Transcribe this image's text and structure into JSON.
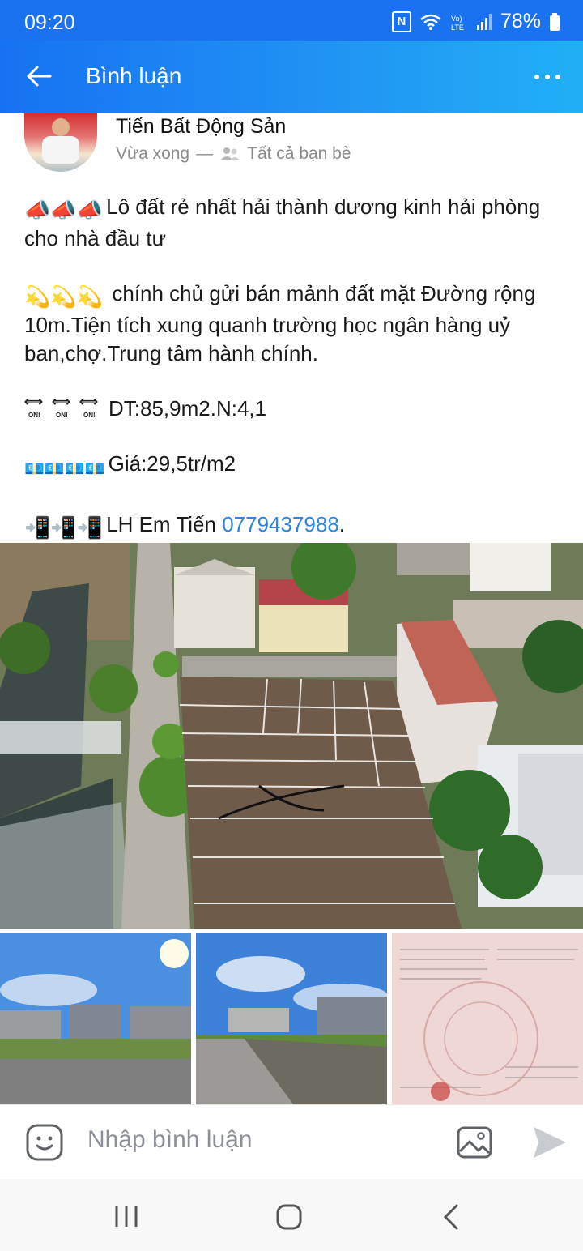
{
  "status_bar": {
    "time": "09:20",
    "battery": "78%",
    "network": "LTE"
  },
  "app_bar": {
    "title": "Bình luận"
  },
  "post": {
    "author": "Tiến Bất Động Sản",
    "time": "Vừa xong",
    "separator": "—",
    "privacy": "Tất cả bạn bè",
    "lines": {
      "headline_emoji": "📣📣📣",
      "headline": "Lô đất rẻ nhất hải thành dương kinh hải phòng cho nhà đầu tư",
      "desc_emoji": "💫💫💫",
      "desc": "chính chủ gửi bán mảnh đất mặt Đường rộng 10m.Tiện tích xung quanh trường học ngân hàng uỷ ban,chợ.Trung tâm hành chính.",
      "area": "DT:85,9m2.N:4,1",
      "price_emoji": "💶💶💶💶",
      "price": "Giá:29,5tr/m2",
      "contact_emoji": "📲📲📲",
      "contact_prefix": "LH Em Tiến ",
      "phone": "0779437988",
      "contact_suffix": "."
    }
  },
  "comment_bar": {
    "placeholder": "Nhập bình luận"
  }
}
